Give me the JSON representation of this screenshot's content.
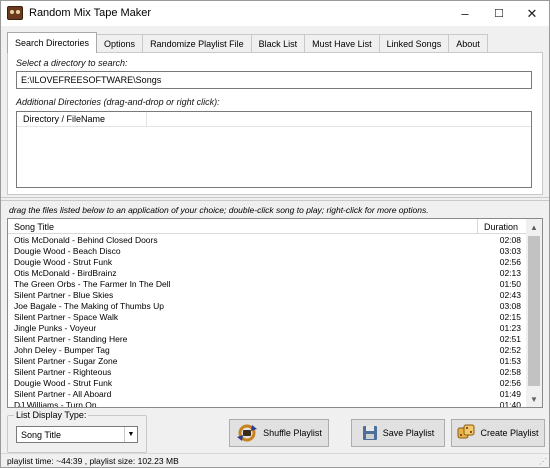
{
  "window": {
    "title": "Random Mix Tape Maker",
    "controls": {
      "minimize": "–",
      "maximize": "☐",
      "close": "✕"
    }
  },
  "tabs": [
    {
      "label": "Search Directories",
      "active": true
    },
    {
      "label": "Options",
      "active": false
    },
    {
      "label": "Randomize Playlist File",
      "active": false
    },
    {
      "label": "Black List",
      "active": false
    },
    {
      "label": "Must Have List",
      "active": false
    },
    {
      "label": "Linked Songs",
      "active": false
    },
    {
      "label": "About",
      "active": false
    }
  ],
  "search": {
    "select_label": "Select a directory to search:",
    "directory_value": "E:\\ILOVEFREESOFTWARE\\Songs",
    "additional_label": "Additional Directories (drag-and-drop or right click):",
    "list_header": "Directory / FileName"
  },
  "hint_text": "drag the files listed below to an application of your choice; double-click song to play; right-click for more options.",
  "songs": {
    "headers": {
      "title": "Song Title",
      "duration": "Duration"
    },
    "rows": [
      {
        "title": "Otis McDonald - Behind Closed Doors",
        "duration": "02:08"
      },
      {
        "title": "Dougie Wood - Beach Disco",
        "duration": "03:03"
      },
      {
        "title": "Dougie Wood - Strut Funk",
        "duration": "02:56"
      },
      {
        "title": "Otis McDonald - BirdBrainz",
        "duration": "02:13"
      },
      {
        "title": "The Green Orbs - The Farmer In The Dell",
        "duration": "01:50"
      },
      {
        "title": "Silent Partner - Blue Skies",
        "duration": "02:43"
      },
      {
        "title": "Joe Bagale - The Making of Thumbs Up",
        "duration": "03:08"
      },
      {
        "title": "Silent Partner - Space Walk",
        "duration": "02:15"
      },
      {
        "title": "Jingle Punks - Voyeur",
        "duration": "01:23"
      },
      {
        "title": "Silent Partner - Standing Here",
        "duration": "02:51"
      },
      {
        "title": "John Deley - Bumper Tag",
        "duration": "02:52"
      },
      {
        "title": "Silent Partner - Sugar Zone",
        "duration": "01:53"
      },
      {
        "title": "Silent Partner - Righteous",
        "duration": "02:58"
      },
      {
        "title": "Dougie Wood - Strut Funk",
        "duration": "02:56"
      },
      {
        "title": "Silent Partner - All Aboard",
        "duration": "01:49"
      },
      {
        "title": "DJ Williams - Turn On",
        "duration": "01:40"
      }
    ]
  },
  "display_type": {
    "legend": "List Display Type:",
    "selected": "Song Title"
  },
  "buttons": {
    "shuffle": "Shuffle Playlist",
    "save": "Save Playlist",
    "create": "Create Playlist"
  },
  "status": "playlist time: ~44:39 , playlist size: 102.23 MB"
}
